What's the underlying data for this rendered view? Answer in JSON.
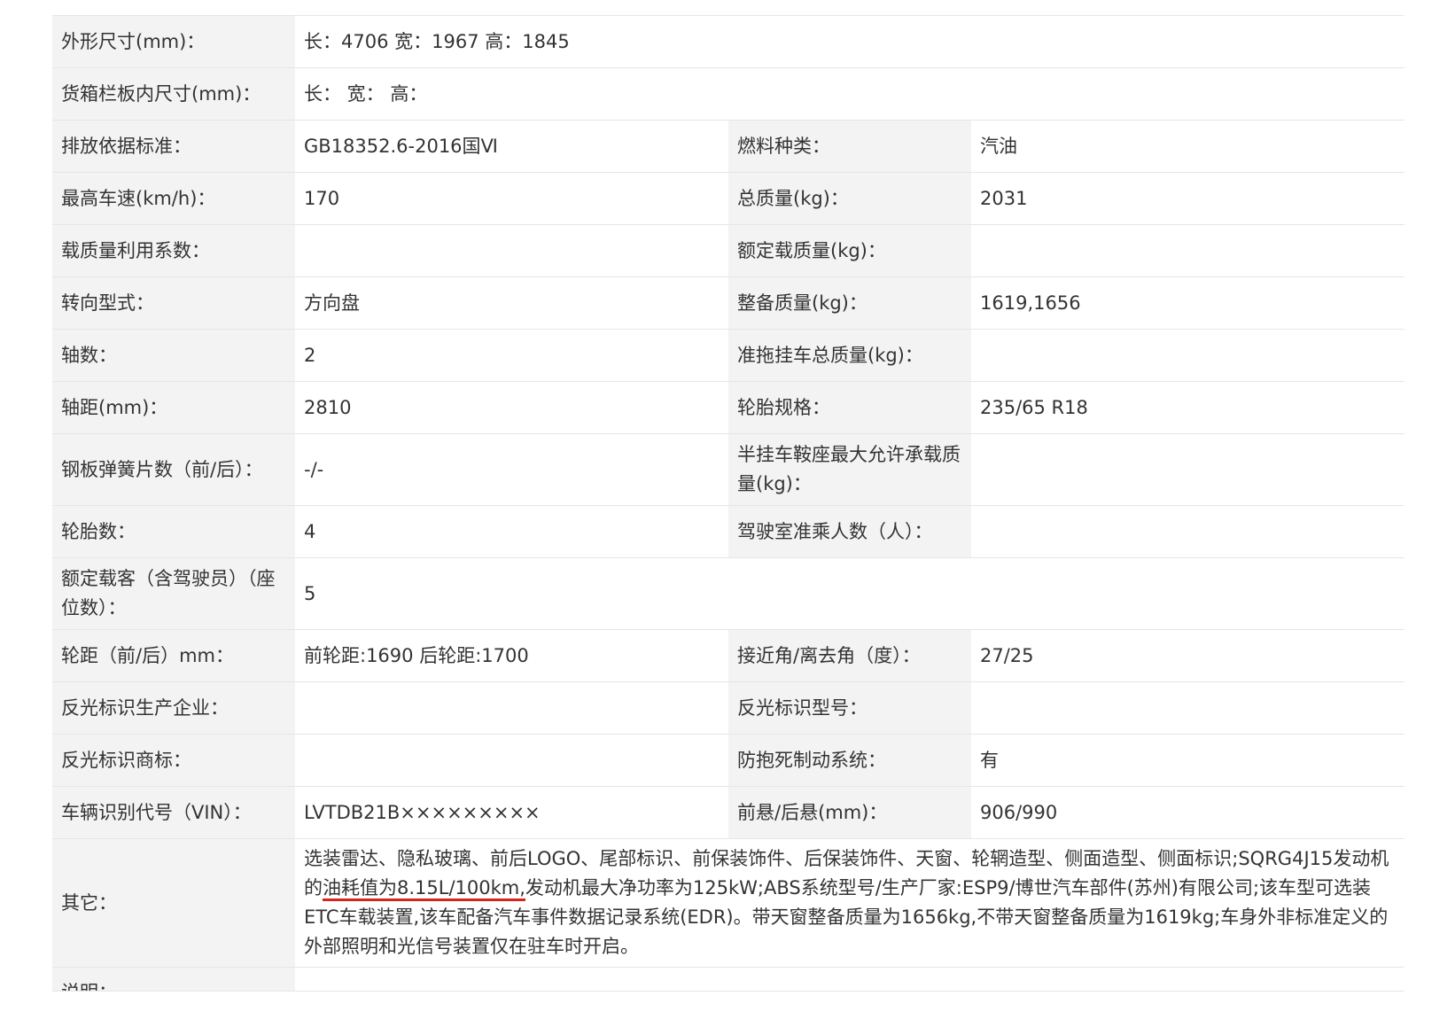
{
  "rows": [
    {
      "label": "外形尺寸(mm)：",
      "value": "长：4706 宽：1967 高：1845"
    },
    {
      "label": "货箱栏板内尺寸(mm)：",
      "value": "长：  宽：  高："
    },
    {
      "label": "排放依据标准：",
      "value": "GB18352.6-2016国Ⅵ",
      "label2": "燃料种类：",
      "value2": "汽油"
    },
    {
      "label": "最高车速(km/h)：",
      "value": "170",
      "label2": "总质量(kg)：",
      "value2": "2031"
    },
    {
      "label": "载质量利用系数：",
      "value": "",
      "label2": "额定载质量(kg)：",
      "value2": ""
    },
    {
      "label": "转向型式：",
      "value": "方向盘",
      "label2": "整备质量(kg)：",
      "value2": "1619,1656"
    },
    {
      "label": "轴数：",
      "value": "2",
      "label2": "准拖挂车总质量(kg)：",
      "value2": ""
    },
    {
      "label": "轴距(mm)：",
      "value": "2810",
      "label2": "轮胎规格：",
      "value2": "235/65 R18"
    },
    {
      "label": "钢板弹簧片数（前/后）：",
      "value": "-/-",
      "label2": "半挂车鞍座最大允许承载质量(kg)：",
      "value2": ""
    },
    {
      "label": "轮胎数：",
      "value": "4",
      "label2": "驾驶室准乘人数（人）：",
      "value2": ""
    },
    {
      "label": "额定载客（含驾驶员）（座位数）：",
      "value": "5"
    },
    {
      "label": "轮距（前/后）mm：",
      "value": "前轮距:1690 后轮距:1700",
      "label2": "接近角/离去角（度）：",
      "value2": "27/25"
    },
    {
      "label": "反光标识生产企业：",
      "value": "",
      "label2": "反光标识型号：",
      "value2": ""
    },
    {
      "label": "反光标识商标：",
      "value": "",
      "label2": "防抱死制动系统：",
      "value2": "有"
    },
    {
      "label": "车辆识别代号（VIN）：",
      "value": "LVTDB21B×××××××××",
      "label2": "前悬/后悬(mm)：",
      "value2": "906/990"
    }
  ],
  "other": {
    "label": "其它：",
    "text_before": "选装雷达、隐私玻璃、前后LOGO、尾部标识、前保装饰件、后保装饰件、天窗、轮辋造型、侧面造型、侧面标识;SQRG4J15发动机的",
    "text_highlight": "油耗值为8.15L/100km,",
    "text_after": "发动机最大净功率为125kW;ABS系统型号/生产厂家:ESP9/博世汽车部件(苏州)有限公司;该车型可选装ETC车载装置,该车配备汽车事件数据记录系统(EDR)。带天窗整备质量为1656kg,不带天窗整备质量为1619kg;车身外非标准定义的外部照明和光信号装置仅在驻车时开启。"
  },
  "last_row_label": "说明：",
  "colors": {
    "label_bg": "#f3f3f3",
    "border": "#e6e6e6",
    "highlight_underline": "#d8251b"
  }
}
